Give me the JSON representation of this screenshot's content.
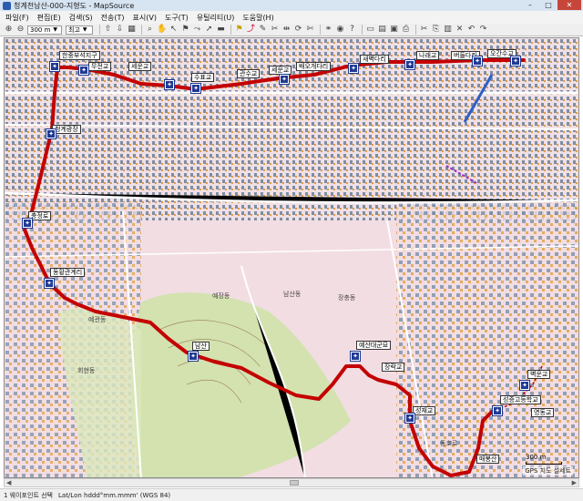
{
  "window": {
    "title": "청계천남산-000-지형도 - MapSource"
  },
  "menu": [
    "파일(F)",
    "편집(E)",
    "검색(S)",
    "전송(T)",
    "표시(V)",
    "도구(T)",
    "유틸리티(U)",
    "도움말(H)"
  ],
  "toolbar": {
    "zoom_value": "300 m",
    "detail_value": "최고"
  },
  "waypoints": [
    "한중부석지구",
    "무전교",
    "세운교",
    "수표교",
    "관수교",
    "세운교",
    "배오개다리",
    "새벽다리",
    "나래교",
    "버들다리",
    "오간수교",
    "모전교",
    "청계광장",
    "충정로",
    "동황관계리",
    "남산",
    "예산대군묘",
    "장락교",
    "성재교",
    "벽운교",
    "영동교",
    "성증고등학교",
    "매봉산"
  ],
  "map_text": [
    "예장동",
    "회현동",
    "예관동",
    "장충동",
    "동호로",
    "남산동",
    "후암동",
    "청파동"
  ],
  "scale": {
    "label": "300 m"
  },
  "gps_note": "GPS 지도 설세트",
  "status": {
    "selection": "1 웨이포인트 선택",
    "coord_format": "Lat/Lon hddd°mm.mmm' (WGS 84)"
  },
  "colors": {
    "route": "#c40000",
    "waypoint_icon": "#1f3a93",
    "park": "#cfe2a8",
    "urban": "#f2dde3"
  }
}
